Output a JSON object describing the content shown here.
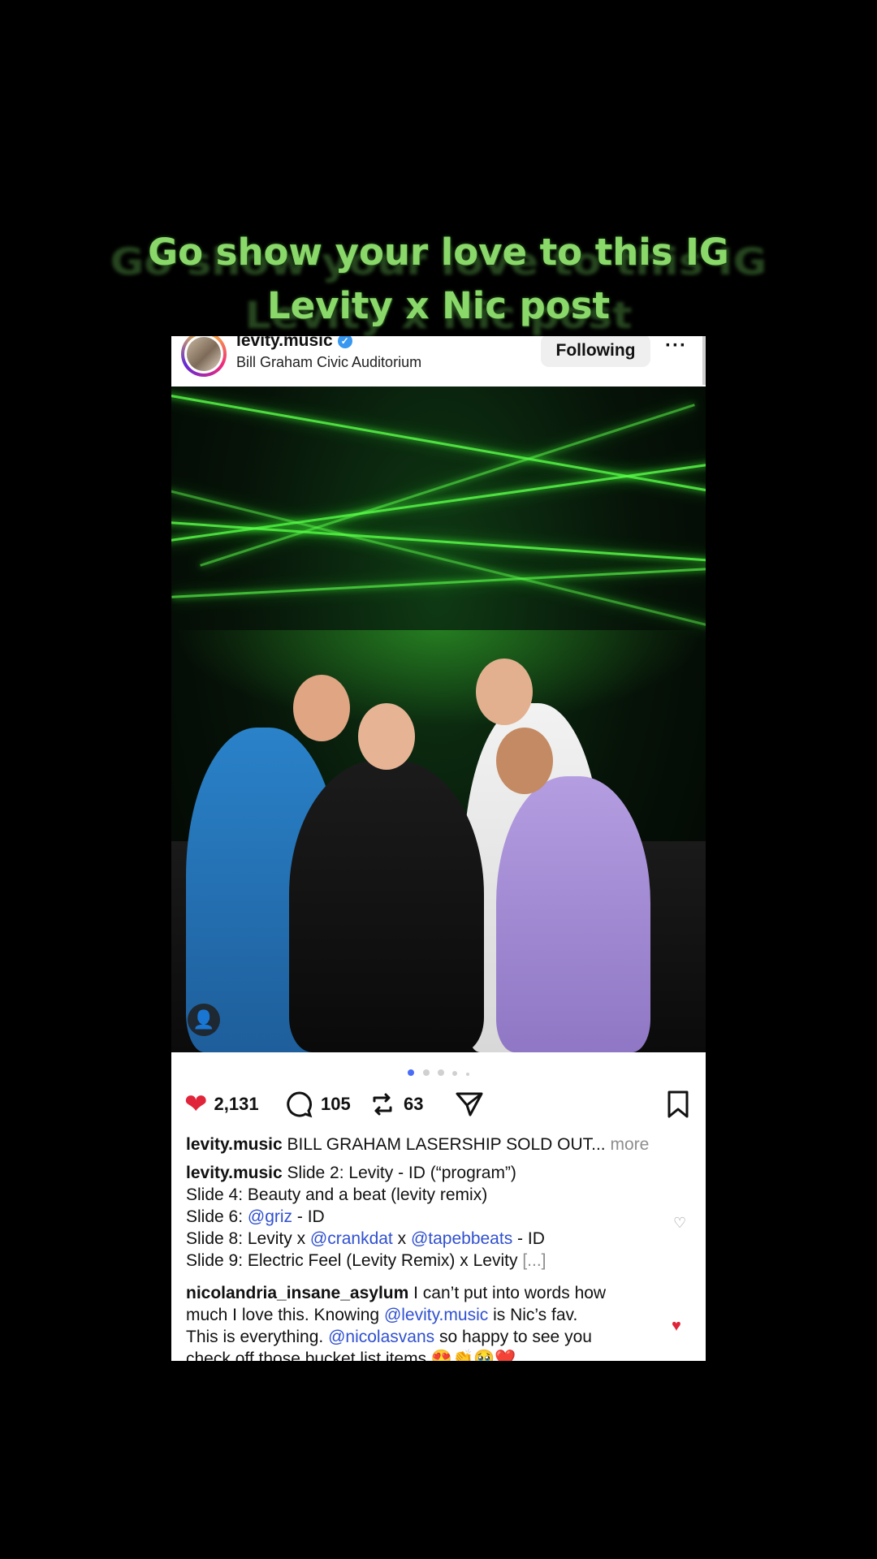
{
  "overlay": {
    "line1": "Go show your love to this IG",
    "line2": "Levity x Nic post"
  },
  "post": {
    "username": "levity.music",
    "location": "Bill Graham Civic Auditorium",
    "follow_label": "Following",
    "more_label": "···",
    "carousel": {
      "total_dots": 5,
      "active_index": 0
    },
    "likes": "2,131",
    "comments": "105",
    "reposts": "63",
    "caption": {
      "user": "levity.music",
      "text": "BILL GRAHAM LASERSHIP SOLD OUT...",
      "more": "more"
    }
  },
  "comments": [
    {
      "user": "levity.music",
      "line1_rest": "Slide 2: Levity - ID (“program”)",
      "line2": "Slide 4: Beauty and a beat (levity remix)",
      "line3_prefix": "Slide 6: ",
      "line3_mention": "@griz",
      "line3_suffix": " - ID",
      "line4_prefix": "Slide 8: Levity x ",
      "line4_mention1": "@crankdat",
      "line4_mid": " x ",
      "line4_mention2": "@tapebbeats",
      "line4_suffix": " - ID",
      "line5": "Slide 9: Electric Feel (Levity Remix) x Levity",
      "line5_more": "[...]",
      "liked": false
    },
    {
      "user": "nicolandria_insane_asylum",
      "line1_rest": "I can’t put into words how",
      "line2_prefix": "much I love this. Knowing ",
      "line2_mention": "@levity.music",
      "line2_suffix": " is Nic’s fav.",
      "line3_prefix": "This is everything. ",
      "line3_mention": "@nicolasvans",
      "line3_suffix": " so happy to see you",
      "line4": "check off those bucket list items 😍👏🥹❤️",
      "liked": true
    }
  ],
  "colors": {
    "accent_green": "#8ad86a",
    "like_red": "#e0243a",
    "mention_blue": "#3050d0"
  }
}
